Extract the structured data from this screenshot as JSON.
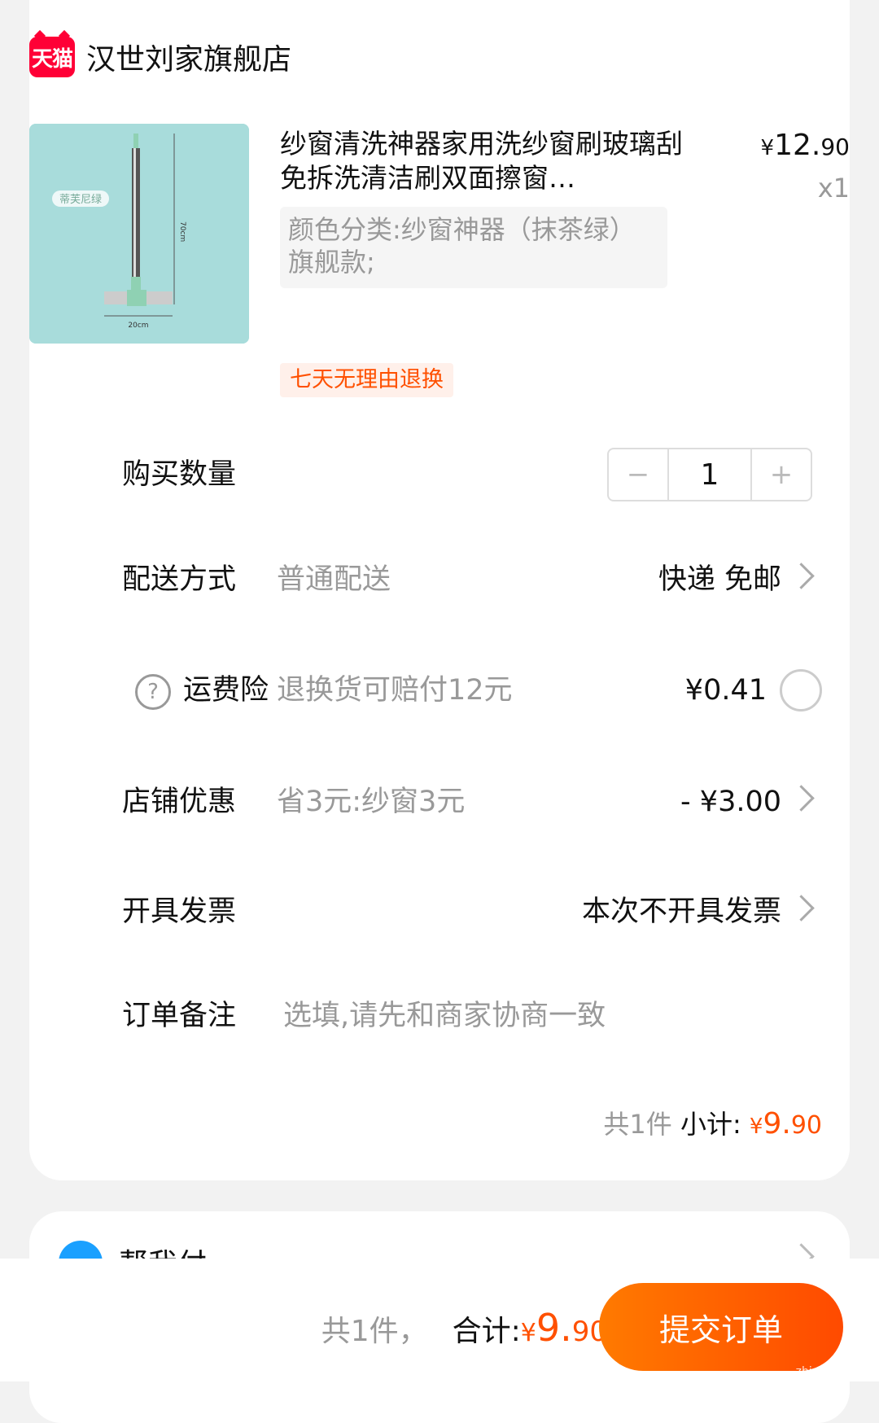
{
  "shop": {
    "badge": "天猫",
    "name": "汉世刘家旗舰店"
  },
  "product": {
    "image_label": "蒂芙尼绿",
    "image_height_text": "70cm",
    "image_width_text": "20cm",
    "title": "纱窗清洗神器家用洗纱窗刷玻璃刮免拆洗清洁刷双面擦窗…",
    "price_symbol": "¥",
    "price_int": "12.",
    "price_cents": "90",
    "quantity_text": "x1",
    "sku": "颜色分类:纱窗神器（抹茶绿）旗舰款;",
    "tag": "七天无理由退换"
  },
  "rows": {
    "quantity": {
      "label": "购买数量",
      "minus": "−",
      "value": "1",
      "plus": "+"
    },
    "delivery": {
      "label": "配送方式",
      "desc": "普通配送",
      "value": "快递 免邮"
    },
    "shipping_insurance": {
      "label": "运费险",
      "help": "?",
      "desc": "退换货可赔付12元",
      "value": "¥0.41"
    },
    "shop_discount": {
      "label": "店铺优惠",
      "desc": "省3元:纱窗3元",
      "value": "- ¥3.00"
    },
    "invoice": {
      "label": "开具发票",
      "value": "本次不开具发票"
    },
    "remark": {
      "label": "订单备注",
      "placeholder": "选填,请先和商家协商一致"
    }
  },
  "subtotal": {
    "count": "共1件",
    "label": "小计:",
    "symbol": "¥",
    "int": "9.",
    "cents": "90"
  },
  "help_pay": {
    "label": "帮我付"
  },
  "footer": {
    "count": "共1件，",
    "label": "合计:",
    "symbol": "¥",
    "int": "9.",
    "cents": "90",
    "submit": "提交订单"
  },
  "watermark": "zhizhizhi.com",
  "colors": {
    "accent": "#ff5000",
    "tmall": "#ff0036",
    "image_bg": "#a8dcdb"
  }
}
